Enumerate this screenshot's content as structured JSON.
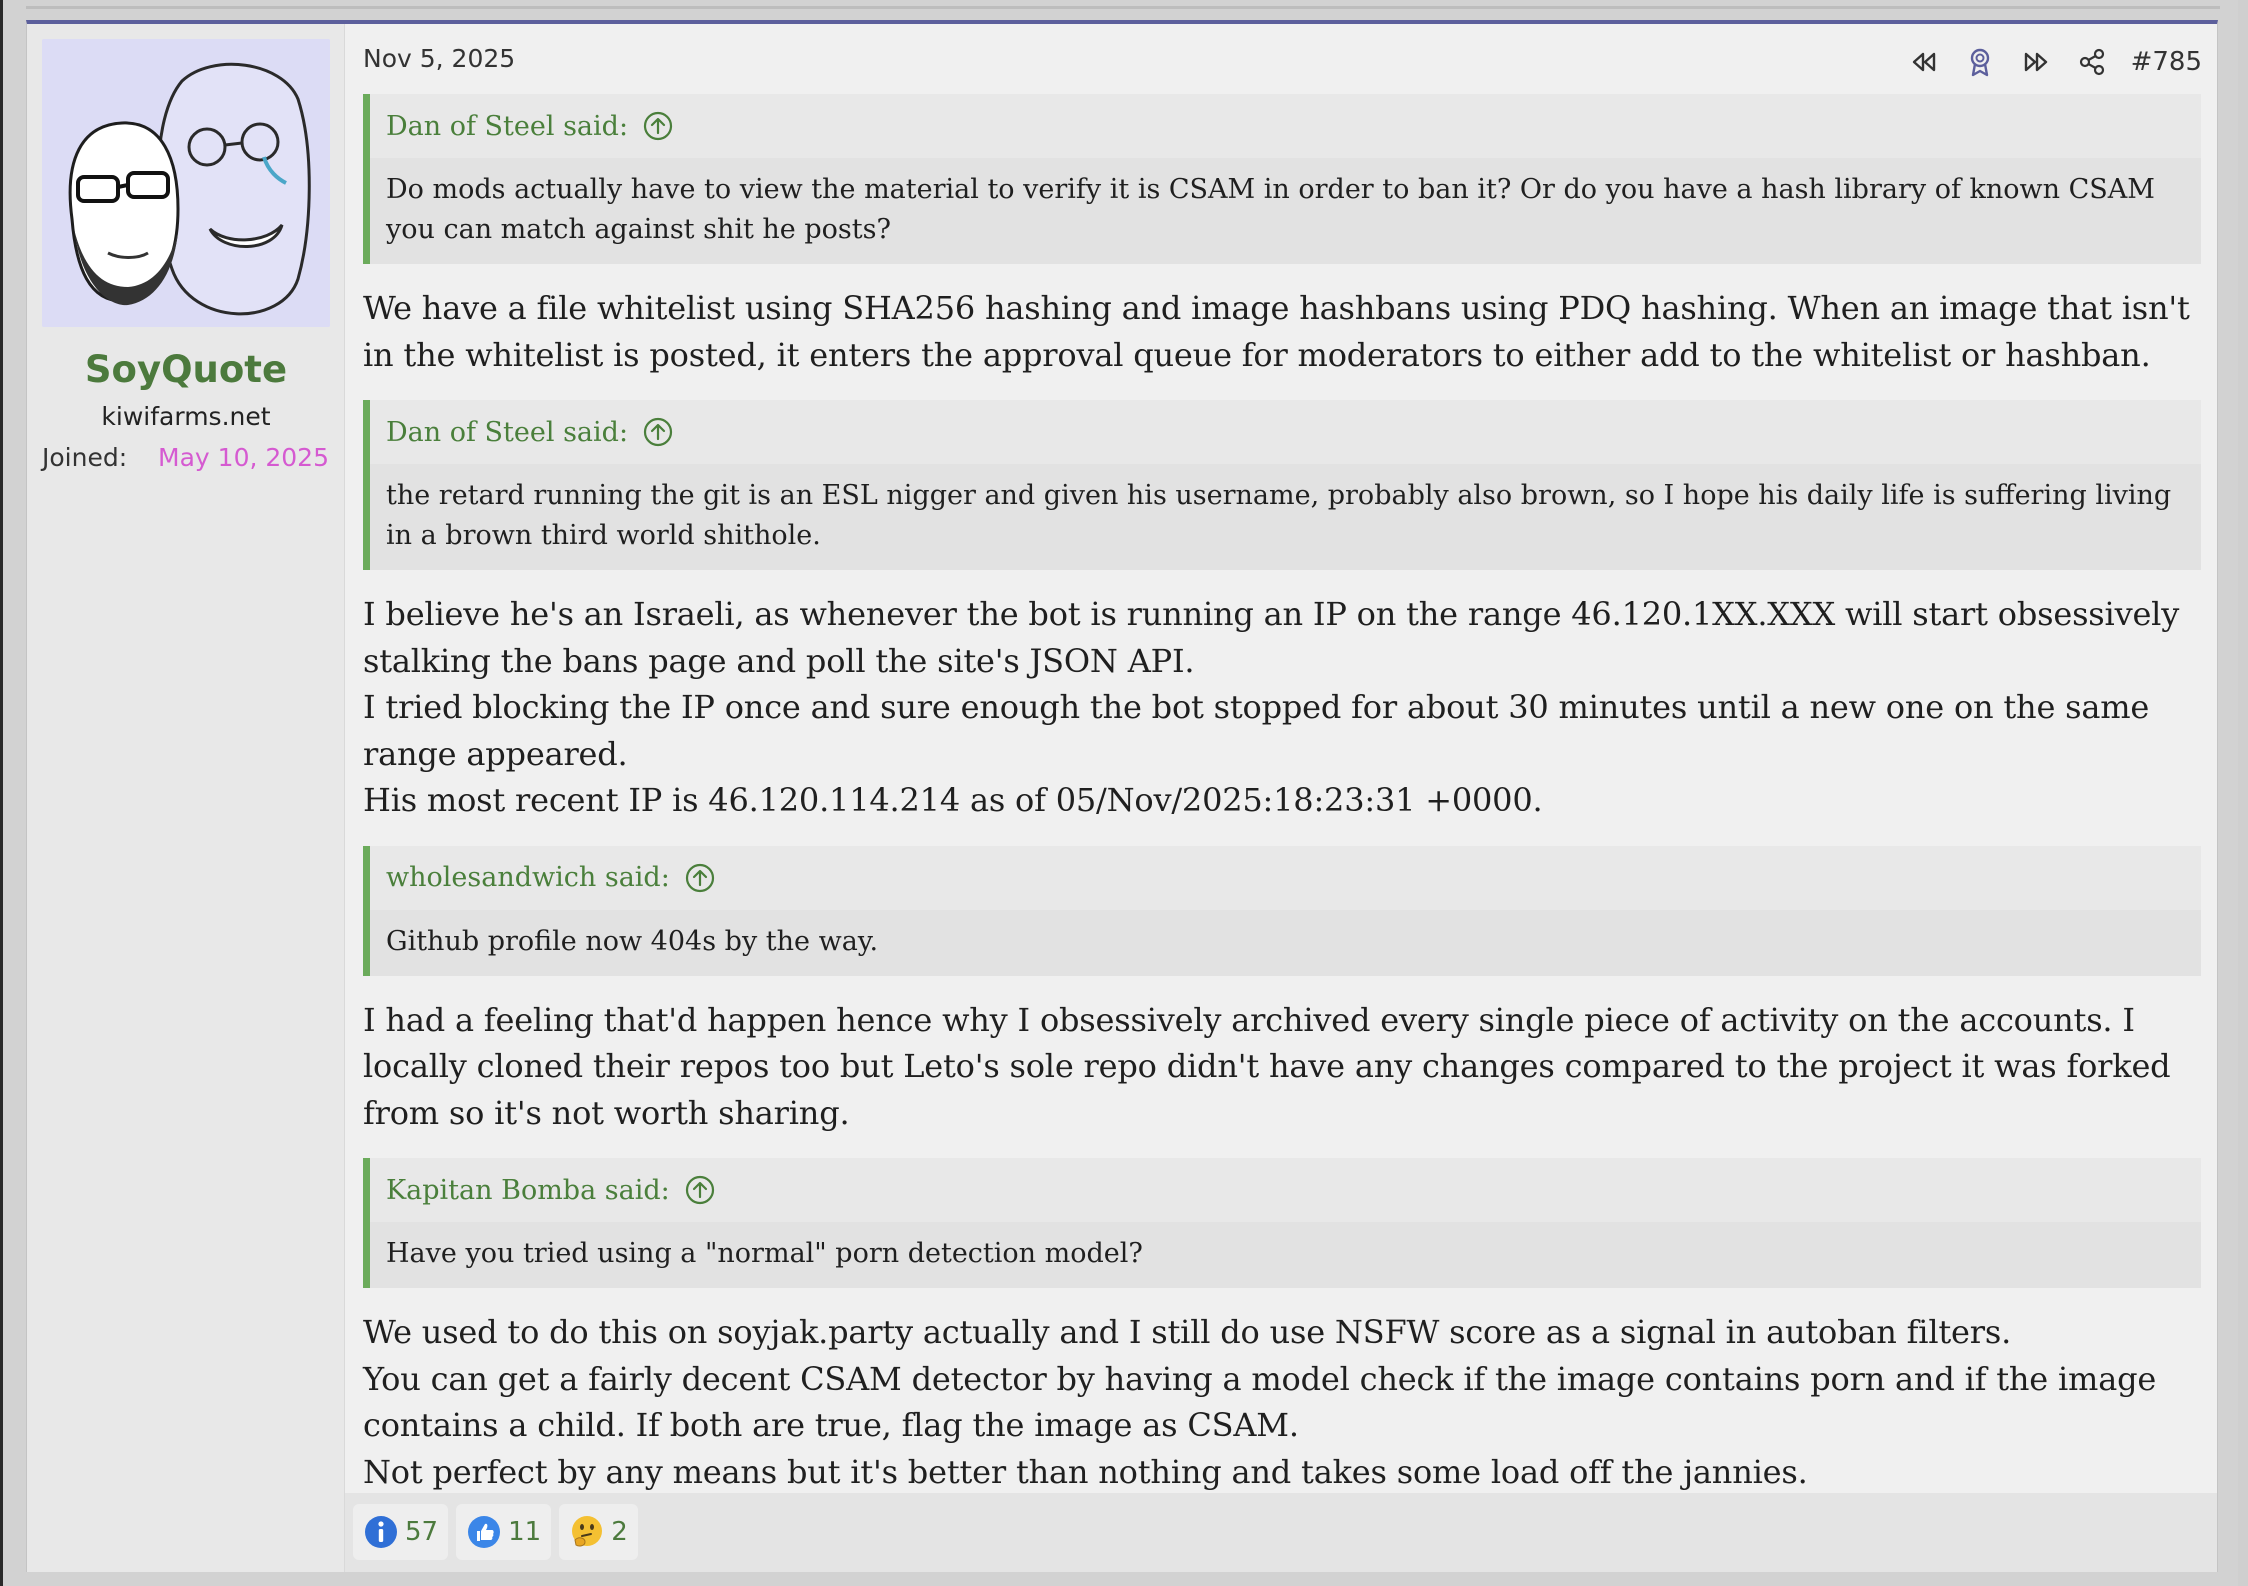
{
  "post": {
    "date": "Nov 5, 2025",
    "number": "#785",
    "actions": [
      "rewind-icon",
      "award-icon",
      "fast-forward-icon",
      "share-icon"
    ]
  },
  "user": {
    "name": "SoyQuote",
    "title": "kiwifarms.net",
    "joined_label": "Joined:",
    "joined_date": "May 10, 2025"
  },
  "content": {
    "q1": {
      "author": "Dan of Steel said:",
      "text": "Do mods actually have to view the material to verify it is CSAM in order to ban it? Or do you have a hash library of known CSAM you can match against shit he posts?"
    },
    "p1": "We have a file whitelist using SHA256 hashing and image hashbans using PDQ hashing. When an image that isn't in the whitelist is posted, it enters the approval queue for moderators to either add to the whitelist or hashban.",
    "q2": {
      "author": "Dan of Steel said:",
      "text": "the retard running the git is an ESL nigger and given his username, probably also brown, so I hope his daily life is suffering living in a brown third world shithole."
    },
    "p2": {
      "l1": "I believe he's an Israeli, as whenever the bot is running an IP on the range 46.120.1XX.XXX will start obsessively stalking the bans page and poll the site's JSON API.",
      "l2": "I tried blocking the IP once and sure enough the bot stopped for about 30 minutes until a new one on the same range appeared.",
      "l3": "His most recent IP is 46.120.114.214 as of 05/Nov/2025:18:23:31 +0000."
    },
    "q3": {
      "author": "wholesandwich said:",
      "text": "Github profile now 404s by the way."
    },
    "p3": "I had a feeling that'd happen hence why I obsessively archived every single piece of activity on the accounts. I locally cloned their repos too but Leto's sole repo didn't have any changes compared to the project it was forked from so it's not worth sharing.",
    "q4": {
      "author": "Kapitan Bomba said:",
      "text": "Have you tried using a \"normal\" porn detection model?"
    },
    "p4": {
      "l1": "We used to do this on soyjak.party actually and I still do use NSFW score as a signal in autoban filters.",
      "l2": "You can get a fairly decent CSAM detector by having a model check if the image contains porn and if the image contains a child. If both are true, flag the image as CSAM.",
      "l3": "Not perfect by any means but it's better than nothing and takes some load off the jannies."
    }
  },
  "reactions": [
    {
      "icon": "informative-icon",
      "count": "57"
    },
    {
      "icon": "thumbs-up-icon",
      "count": "11"
    },
    {
      "icon": "thinking-emoji-icon",
      "count": "2"
    }
  ],
  "colors": {
    "accent_border": "#5c5f9c",
    "username": "#4c7a3d",
    "joined_date": "#d55ad1",
    "quote_bar": "#6bab5b"
  }
}
